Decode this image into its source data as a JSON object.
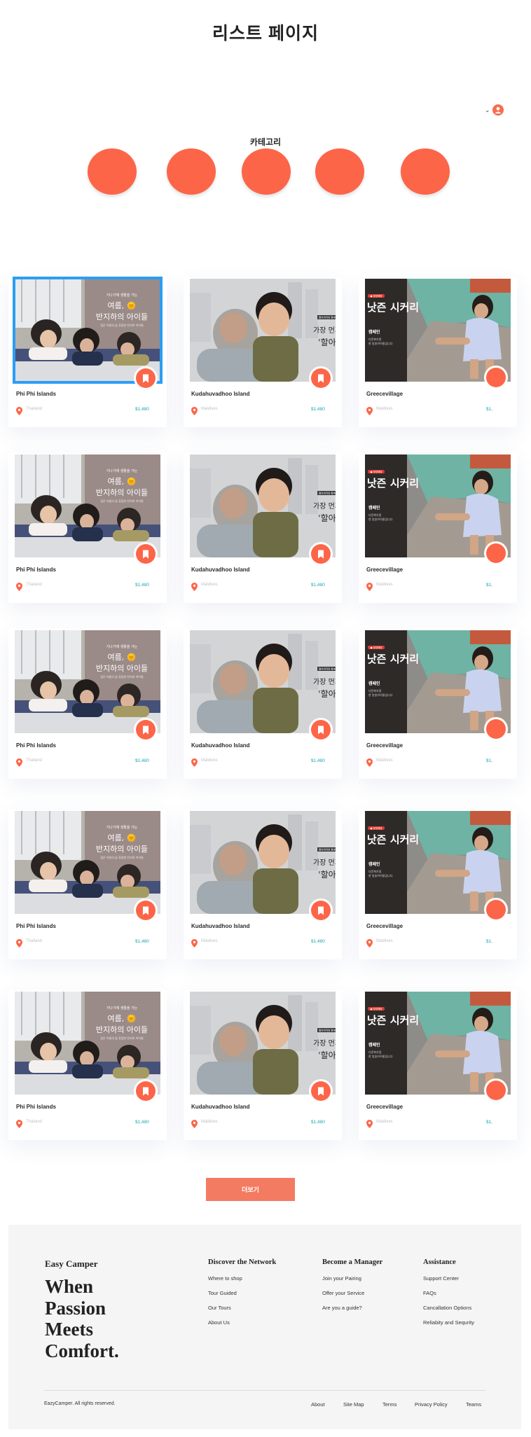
{
  "page": {
    "title": "리스트 페이지"
  },
  "header": {
    "chevron": "⌄",
    "avatar_icon": "user-icon"
  },
  "categories": {
    "label": "카테고리",
    "count": 5
  },
  "products": [
    {
      "name": "Phi Phi Islands",
      "location": "Thailand",
      "price": "$1,480"
    },
    {
      "name": "Kudahuvadhoo Island",
      "location": "Maldives",
      "price": "$1,480"
    },
    {
      "name": "Greecevillage",
      "location": "Maldives",
      "price": "$1,"
    },
    {
      "name": "Phi Phi Islands",
      "location": "Thailand",
      "price": "$1,480"
    },
    {
      "name": "Kudahuvadhoo Island",
      "location": "Maldives",
      "price": "$1,480"
    },
    {
      "name": "Greecevillage",
      "location": "Maldives",
      "price": "$1,"
    },
    {
      "name": "Phi Phi Islands",
      "location": "Thailand",
      "price": "$1,480"
    },
    {
      "name": "Kudahuvadhoo Island",
      "location": "Maldives",
      "price": "$1,480"
    },
    {
      "name": "Greecevillage",
      "location": "Maldives",
      "price": "$1,"
    },
    {
      "name": "Phi Phi Islands",
      "location": "Thailand",
      "price": "$1,480"
    },
    {
      "name": "Kudahuvadhoo Island",
      "location": "Maldives",
      "price": "$1,480"
    },
    {
      "name": "Greecevillage",
      "location": "Maldives",
      "price": "$1,"
    },
    {
      "name": "Phi Phi Islands",
      "location": "Thailand",
      "price": "$1,480"
    },
    {
      "name": "Kudahuvadhoo Island",
      "location": "Maldives",
      "price": "$1,480"
    },
    {
      "name": "Greecevillage",
      "location": "Maldives",
      "price": "$1,"
    }
  ],
  "posters": {
    "a": {
      "tag": "가나가재 생활을 가는",
      "line1": "여름, 🌞",
      "line2": "반지하의 아이들",
      "sub": "집은 아들의 꿈 휴잠한 반지하 아이들"
    },
    "b": {
      "tag": "할아버지와 함께",
      "line1": "가장 먼저",
      "line2": "'할아"
    },
    "c": {
      "badge": "● 방영예정",
      "title": "낫즌 시커리",
      "ch": "캠페인",
      "sub1": "다문화가정",
      "sub2": "한 방송아이들입니다"
    }
  },
  "more_button": {
    "label": "더보기"
  },
  "footer": {
    "brand": "Easy Camper",
    "slogan": [
      "When",
      "Passion",
      "Meets",
      "Comfort."
    ],
    "columns": [
      {
        "title": "Discover the Network",
        "links": [
          "Where to shop",
          "Tour Guided",
          "Our Tours",
          "About Us"
        ]
      },
      {
        "title": "Become a Manager",
        "links": [
          "Join your Pairing",
          "Offer your Service",
          "Are you a guide?"
        ]
      },
      {
        "title": "Assistance",
        "links": [
          "Support Center",
          "FAQs",
          "Cancallation Options",
          "Reliabity and Sequrity"
        ]
      }
    ],
    "copyright": "EazyCamper. All rights reserved.",
    "legal": [
      "About",
      "Site Map",
      "Terms",
      "Privacy Policy",
      "Teams"
    ]
  },
  "colors": {
    "accent": "#fd6548",
    "price": "#1aa8a8",
    "select": "#2b9df4",
    "button": "#f37b62"
  }
}
